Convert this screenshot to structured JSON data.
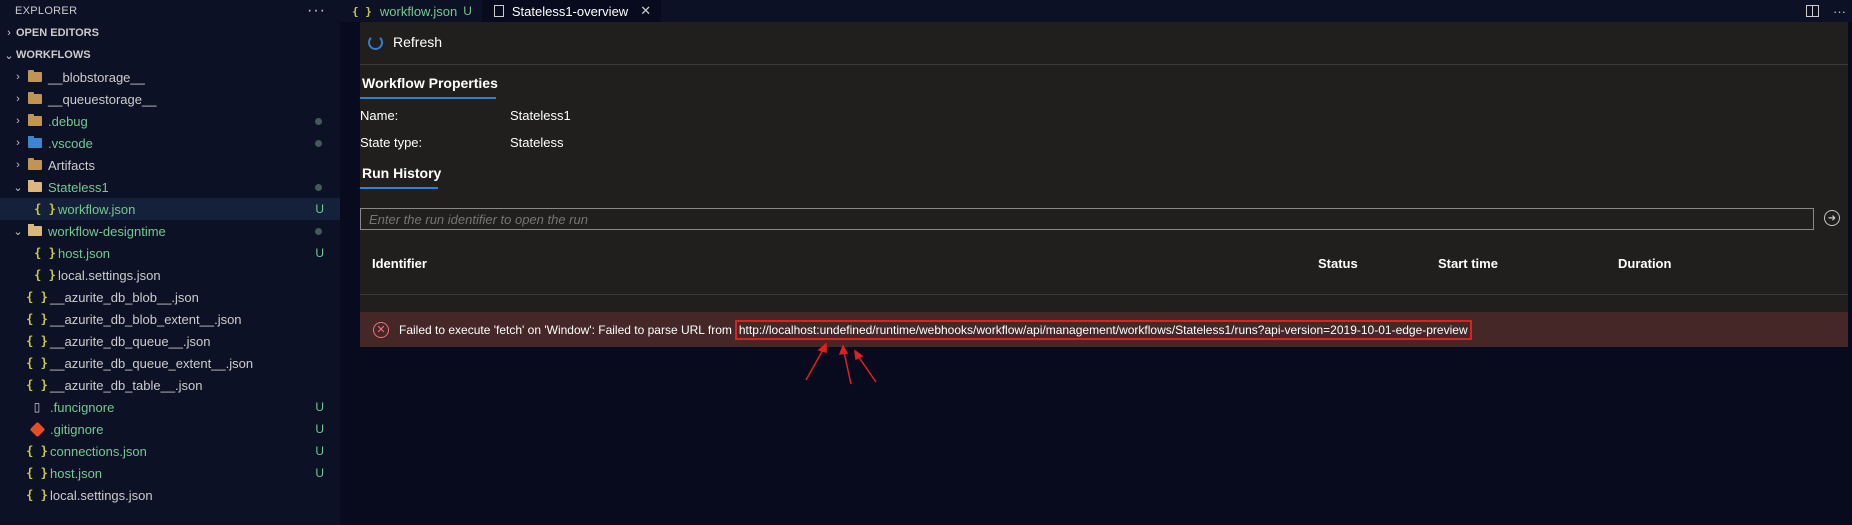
{
  "sidebar": {
    "title": "EXPLORER",
    "more": "···",
    "open_editors": "OPEN EDITORS",
    "workflows": "WORKFLOWS",
    "items": [
      {
        "label": "__blobstorage__"
      },
      {
        "label": "__queuestorage__"
      },
      {
        "label": ".debug"
      },
      {
        "label": ".vscode"
      },
      {
        "label": "Artifacts"
      },
      {
        "label": "Stateless1"
      },
      {
        "label": "workflow.json",
        "badge": "U"
      },
      {
        "label": "workflow-designtime"
      },
      {
        "label": "host.json",
        "badge": "U"
      },
      {
        "label": "local.settings.json"
      },
      {
        "label": "__azurite_db_blob__.json"
      },
      {
        "label": "__azurite_db_blob_extent__.json"
      },
      {
        "label": "__azurite_db_queue__.json"
      },
      {
        "label": "__azurite_db_queue_extent__.json"
      },
      {
        "label": "__azurite_db_table__.json"
      },
      {
        "label": ".funcignore",
        "badge": "U"
      },
      {
        "label": ".gitignore",
        "badge": "U"
      },
      {
        "label": "connections.json",
        "badge": "U"
      },
      {
        "label": "host.json",
        "badge": "U"
      },
      {
        "label": "local.settings.json"
      }
    ]
  },
  "tabs": [
    {
      "label": "workflow.json",
      "badge": "U"
    },
    {
      "label": "Stateless1-overview",
      "close": "✕"
    }
  ],
  "toolbar": {
    "refresh_label": "Refresh"
  },
  "properties": {
    "title": "Workflow Properties",
    "name_label": "Name:",
    "name_value": "Stateless1",
    "state_label": "State type:",
    "state_value": "Stateless"
  },
  "run_history": {
    "title": "Run History",
    "placeholder": "Enter the run identifier to open the run",
    "columns": [
      "Identifier",
      "Status",
      "Start time",
      "Duration"
    ]
  },
  "error": {
    "message": "Failed to execute 'fetch' on 'Window': Failed to parse URL from",
    "url": "http://localhost:undefined/runtime/webhooks/workflow/api/management/workflows/Stateless1/runs?api-version=2019-10-01-edge-preview"
  },
  "colors": {
    "accent": "#2f80d1",
    "error_bg": "#442726",
    "error_highlight": "#e02020",
    "git_untracked": "#73c991"
  }
}
